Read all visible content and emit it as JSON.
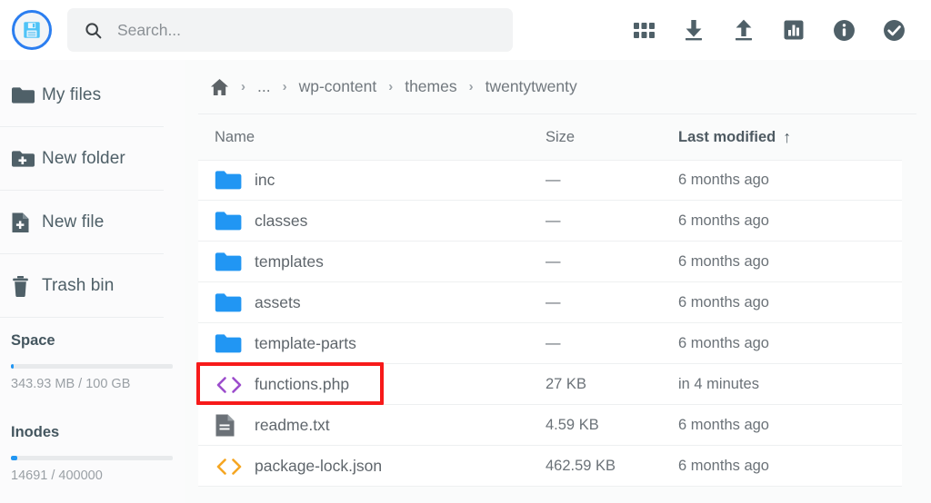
{
  "app": {
    "logo_icon": "floppy-disk-save-icon",
    "accent_blue": "#2196f3",
    "icon_slate": "#4f6068",
    "highlight_color": "#f71a1a"
  },
  "search": {
    "placeholder": "Search...",
    "value": "",
    "icon": "search-icon"
  },
  "toolbar": {
    "actions": [
      {
        "name": "apps-grid-icon",
        "label": "Grid view"
      },
      {
        "name": "download-icon",
        "label": "Download"
      },
      {
        "name": "upload-icon",
        "label": "Upload"
      },
      {
        "name": "stats-chart-icon",
        "label": "Statistics"
      },
      {
        "name": "info-icon",
        "label": "Info"
      },
      {
        "name": "check-circle-icon",
        "label": "Select"
      }
    ]
  },
  "sidebar": {
    "items": [
      {
        "label": "My files",
        "icon": "folder-icon"
      },
      {
        "label": "New folder",
        "icon": "folder-plus-icon"
      },
      {
        "label": "New file",
        "icon": "file-plus-icon"
      },
      {
        "label": "Trash bin",
        "icon": "trash-icon"
      }
    ],
    "meters": [
      {
        "title": "Space",
        "text": "343.93 MB / 100 GB",
        "percent": 1.5,
        "used": "343.93 MB",
        "total": "100 GB"
      },
      {
        "title": "Inodes",
        "text": "14691 / 400000",
        "percent": 4,
        "used": "14691",
        "total": "400000"
      }
    ]
  },
  "breadcrumb": {
    "home_icon": "home-icon",
    "separator": "›",
    "items": [
      "...",
      "wp-content",
      "themes",
      "twentytwenty"
    ]
  },
  "table": {
    "columns": {
      "name": "Name",
      "size": "Size",
      "modified": "Last modified",
      "sort_icon": "↑",
      "sort_direction": "ascending",
      "sorted_by": "Last modified"
    },
    "rows": [
      {
        "name": "inc",
        "size": "—",
        "modified": "6 months ago",
        "icon": "folder-icon",
        "icon_kind": "folder",
        "icon_color": "#2196f3",
        "highlighted": false
      },
      {
        "name": "classes",
        "size": "—",
        "modified": "6 months ago",
        "icon": "folder-icon",
        "icon_kind": "folder",
        "icon_color": "#2196f3",
        "highlighted": false
      },
      {
        "name": "templates",
        "size": "—",
        "modified": "6 months ago",
        "icon": "folder-icon",
        "icon_kind": "folder",
        "icon_color": "#2196f3",
        "highlighted": false
      },
      {
        "name": "assets",
        "size": "—",
        "modified": "6 months ago",
        "icon": "folder-icon",
        "icon_kind": "folder",
        "icon_color": "#2196f3",
        "highlighted": false
      },
      {
        "name": "template-parts",
        "size": "—",
        "modified": "6 months ago",
        "icon": "folder-icon",
        "icon_kind": "folder",
        "icon_color": "#2196f3",
        "highlighted": false
      },
      {
        "name": "functions.php",
        "size": "27 KB",
        "modified": "in 4 minutes",
        "icon": "code-file-icon",
        "icon_kind": "code",
        "icon_color": "#9c4dcc",
        "highlighted": true
      },
      {
        "name": "readme.txt",
        "size": "4.59 KB",
        "modified": "6 months ago",
        "icon": "text-file-icon",
        "icon_kind": "document",
        "icon_color": "#6b7177",
        "highlighted": false
      },
      {
        "name": "package-lock.json",
        "size": "462.59 KB",
        "modified": "6 months ago",
        "icon": "code-file-icon",
        "icon_kind": "code",
        "icon_color": "#f5a623",
        "highlighted": false
      }
    ]
  }
}
